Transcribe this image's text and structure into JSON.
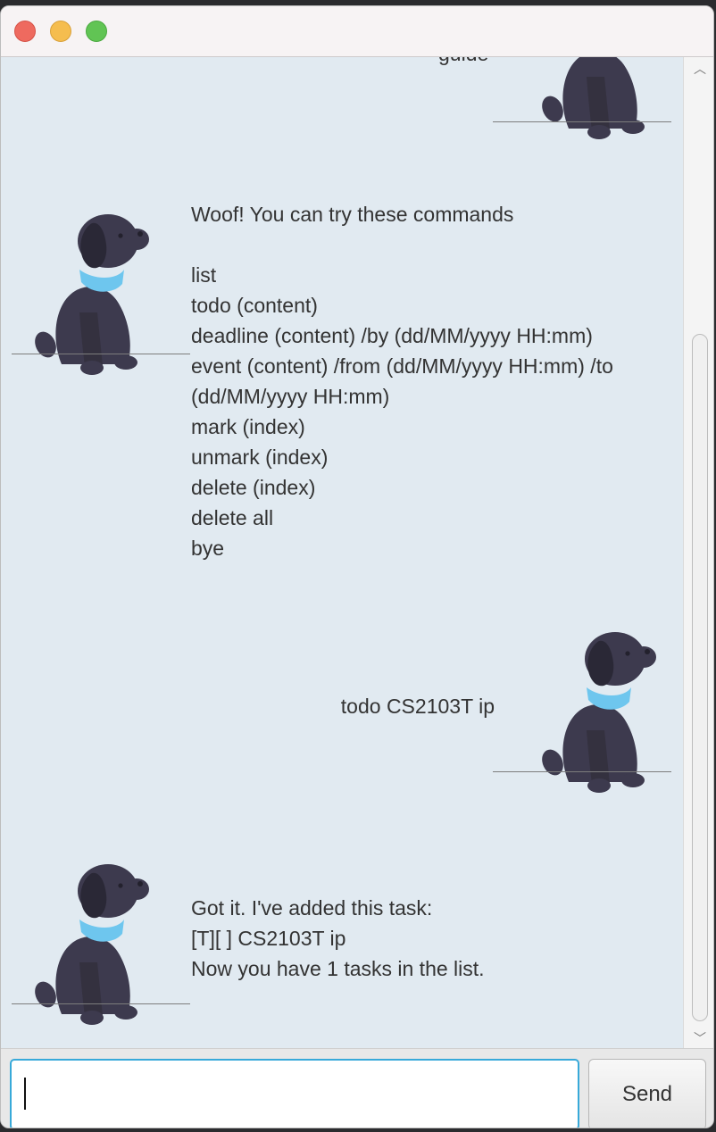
{
  "window": {
    "traffic_lights": {
      "close": "#ee6a5f",
      "minimize": "#f5bd4f",
      "maximize": "#61c454"
    }
  },
  "chat": {
    "background": "#e1eaf1",
    "messages": [
      {
        "sender": "user",
        "text": "guide",
        "partial": true
      },
      {
        "sender": "bot",
        "text": "Woof! You can try these commands\n\nlist\ntodo (content)\ndeadline (content) /by (dd/MM/yyyy HH:mm)\nevent (content) /from (dd/MM/yyyy HH:mm) /to\n(dd/MM/yyyy HH:mm)\nmark (index)\nunmark (index)\ndelete (index)\ndelete all\nbye"
      },
      {
        "sender": "user",
        "text": "todo CS2103T ip"
      },
      {
        "sender": "bot",
        "text": "Got it. I've added this task:\n[T][ ] CS2103T ip\nNow you have 1 tasks in the list."
      }
    ],
    "avatar": "dog-icon",
    "avatar_colors": {
      "body": "#3d3a4e",
      "ear": "#2c2a38",
      "collar": "#6ec6ee"
    }
  },
  "input": {
    "value": "",
    "placeholder": "",
    "focus_color": "#38a9d9"
  },
  "send_button": {
    "label": "Send"
  },
  "scrollbar": {
    "up": "︿",
    "down": "﹀"
  }
}
